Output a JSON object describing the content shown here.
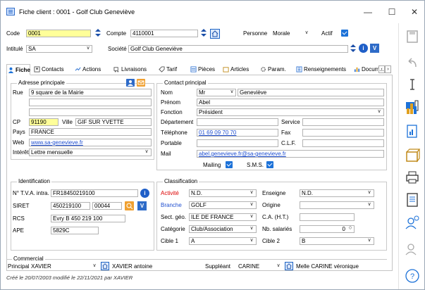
{
  "window": {
    "title": "Fiche client : 0001 - Golf Club Geneviève",
    "min": "—",
    "max": "☐",
    "close": "✕"
  },
  "header": {
    "code_label": "Code",
    "code_value": "0001",
    "compte_label": "Compte",
    "compte_value": "4110001",
    "personne_label": "Personne",
    "personne_value": "Morale",
    "actif_label": "Actif",
    "intitule_label": "Intitulé",
    "intitule_value": "SA",
    "societe_label": "Société",
    "societe_value": "Golf Club Geneviève"
  },
  "tabs": [
    "Fiche",
    "Contacts",
    "Actions",
    "Livraisons",
    "Tarif",
    "Pièces",
    "Articles",
    "Param.",
    "Renseignements",
    "Docum..."
  ],
  "adresse": {
    "title": "Adresse principale",
    "rue_label": "Rue",
    "rue_value": "9 square de la Mairie",
    "cp_label": "CP",
    "cp_value": "91190",
    "ville_label": "Ville",
    "ville_value": "GIF SUR YVETTE",
    "pays_label": "Pays",
    "pays_value": "FRANCE",
    "web_label": "Web",
    "web_value": "www.sa-genevieve.fr",
    "interet_label": "Intérêt",
    "interet_value": "Lettre mensuelle"
  },
  "contact": {
    "title": "Contact principal",
    "nom_label": "Nom",
    "civ_value": "Mr",
    "nom_value": "Geneviève",
    "prenom_label": "Prénom",
    "prenom_value": "Abel",
    "fonction_label": "Fonction",
    "fonction_value": "Président",
    "departement_label": "Département",
    "service_label": "Service",
    "telephone_label": "Téléphone",
    "telephone_value": "01 69 09 70 70",
    "fax_label": "Fax",
    "portable_label": "Portable",
    "clf_label": "C.L.F.",
    "mail_label": "Mail",
    "mail_value": "abel.genevieve.fr@sa-genevieve.fr",
    "mailing_label": "Mailing",
    "sms_label": "S.M.S."
  },
  "identification": {
    "title": "Identification",
    "tva_label": "N° T.V.A. intra.",
    "tva_value": "FR18450219100",
    "siret_label": "SIRET",
    "siret_value": "450219100",
    "siret_value2": "00044",
    "rcs_label": "RCS",
    "rcs_value": "Evry B 450 219 100",
    "ape_label": "APE",
    "ape_value": "5829C"
  },
  "classification": {
    "title": "Classification",
    "activite_label": "Activité",
    "activite_value": "N.D.",
    "enseigne_label": "Enseigne",
    "enseigne_value": "N.D.",
    "branche_label": "Branche",
    "branche_value": "GOLF",
    "origine_label": "Origine",
    "sect_label": "Sect. géo.",
    "sect_value": "ILE DE FRANCE",
    "ca_label": "C.A. (H.T.)",
    "categorie_label": "Catégorie",
    "categorie_value": "Club/Association",
    "nb_label": "Nb. salariés",
    "nb_value": "0",
    "cible1_label": "Cible 1",
    "cible1_value": "A",
    "cible2_label": "Cible 2",
    "cible2_value": "B"
  },
  "commercial": {
    "title": "Commercial",
    "principal_label": "Principal",
    "principal_value": "XAVIER",
    "principal_name": "XAVIER antoine",
    "suppleant_label": "Suppléant",
    "suppleant_value": "CARINE",
    "suppleant_name": "Melle CARINE véronique"
  },
  "status": "Créé le 20/07/2003 modifié le 22/11/2021 par XAVIER",
  "colors": {
    "accent": "#1d72d8",
    "yellow": "#ffff99",
    "link": "#1f4fd0",
    "red": "#d00000"
  }
}
